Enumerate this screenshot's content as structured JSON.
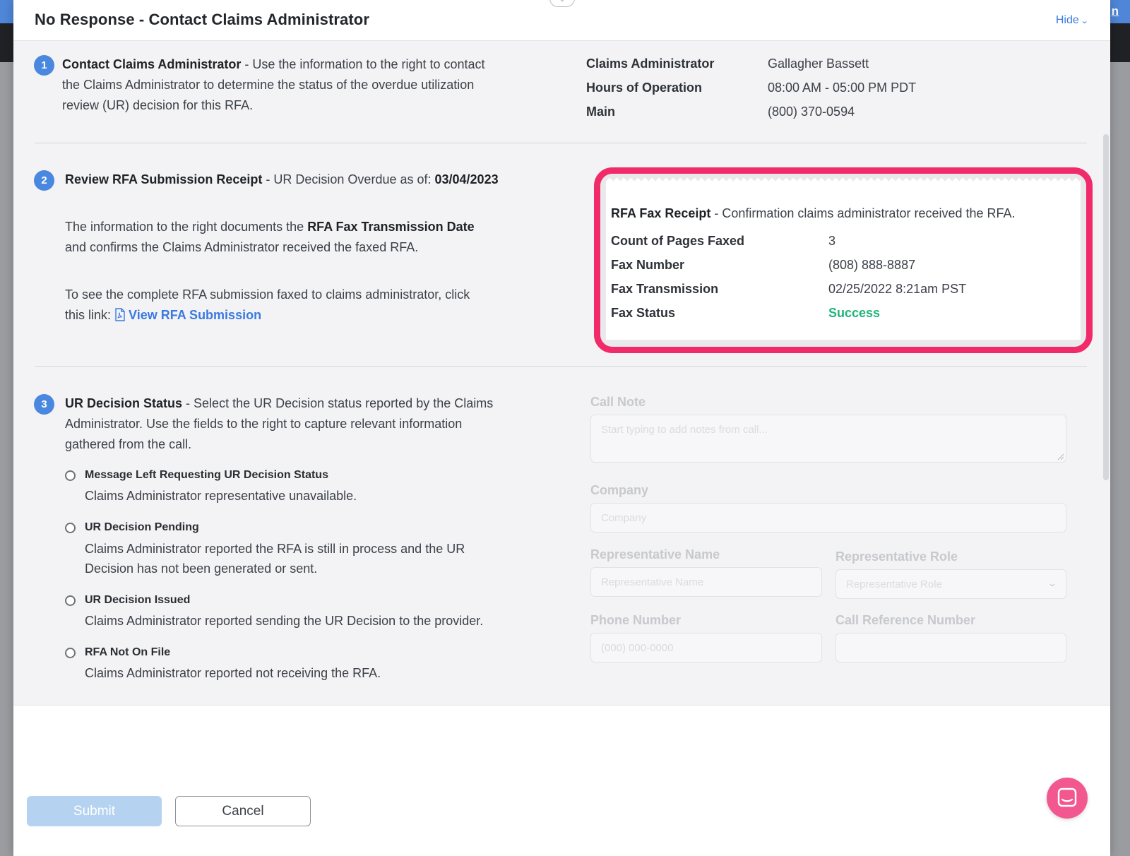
{
  "background": {
    "corner_link": "n"
  },
  "modal": {
    "title": "No Response - Contact Claims Administrator",
    "hide_label": "Hide"
  },
  "step1": {
    "number": "1",
    "title": "Contact Claims Administrator",
    "text_line1": " - Use the information to the right to contact",
    "text_line2": "the Claims Administrator to determine the status of the overdue utilization",
    "text_line3": "review (UR) decision for this RFA.",
    "info": [
      {
        "label": "Claims Administrator",
        "value": "Gallagher Bassett"
      },
      {
        "label": "Hours of Operation",
        "value": "08:00 AM - 05:00 PM PDT"
      },
      {
        "label": "Main",
        "value": "(800) 370-0594"
      }
    ]
  },
  "step2": {
    "number": "2",
    "title": "Review RFA Submission Receipt",
    "overdue_prefix": " - UR Decision Overdue as of: ",
    "overdue_date": "03/04/2023",
    "para1_a": "The information to the right documents the ",
    "para1_b": "RFA Fax Transmission Date",
    "para1_line2": "and confirms the Claims Administrator received the faxed RFA.",
    "para2_line1": "To see the complete RFA submission faxed to claims administrator, click",
    "para2_prefix": "this link: ",
    "link_label": "View RFA Submission",
    "receipt": {
      "title": "RFA Fax Receipt",
      "subtitle": " - Confirmation claims administrator received the RFA.",
      "rows": [
        {
          "label": "Count of Pages Faxed",
          "value": "3"
        },
        {
          "label": "Fax Number",
          "value": "(808) 888-8887"
        },
        {
          "label": "Fax Transmission",
          "value": "02/25/2022 8:21am PST"
        },
        {
          "label": "Fax Status",
          "value": "Success"
        }
      ],
      "status_color": "#1fb57a",
      "highlight_color": "#f12b6a"
    }
  },
  "step3": {
    "number": "3",
    "title": "UR Decision Status",
    "text_line1": " - Select the UR Decision status reported by the Claims",
    "text_line2": "Administrator. Use the fields to the right to capture relevant information",
    "text_line3": "gathered from the call.",
    "options": [
      {
        "title": "Message Left Requesting UR Decision Status",
        "desc": [
          "Claims Administrator representative unavailable."
        ]
      },
      {
        "title": "UR Decision Pending",
        "desc": [
          "Claims Administrator reported the RFA is still in process and the UR",
          "Decision has not been generated or sent."
        ]
      },
      {
        "title": "UR Decision Issued",
        "desc": [
          "Claims Administrator reported sending the UR Decision to the provider."
        ]
      },
      {
        "title": "RFA Not On File",
        "desc": [
          "Claims Administrator reported not receiving the RFA."
        ]
      }
    ],
    "form": {
      "call_note_label": "Call Note",
      "call_note_placeholder": "Start typing to add notes from call...",
      "company_label": "Company",
      "company_placeholder": "Company",
      "rep_name_label": "Representative Name",
      "rep_name_placeholder": "Representative Name",
      "rep_role_label": "Representative Role",
      "rep_role_placeholder": "Representative Role",
      "phone_label": "Phone Number",
      "phone_placeholder": "(000) 000-0000",
      "call_ref_label": "Call Reference Number",
      "call_ref_placeholder": ""
    }
  },
  "footer": {
    "submit_label": "Submit",
    "cancel_label": "Cancel"
  },
  "colors": {
    "accent": "#4a87df",
    "link": "#3a7ae0",
    "submit_disabled": "#b5d3f1",
    "chat": "#f2588f"
  }
}
